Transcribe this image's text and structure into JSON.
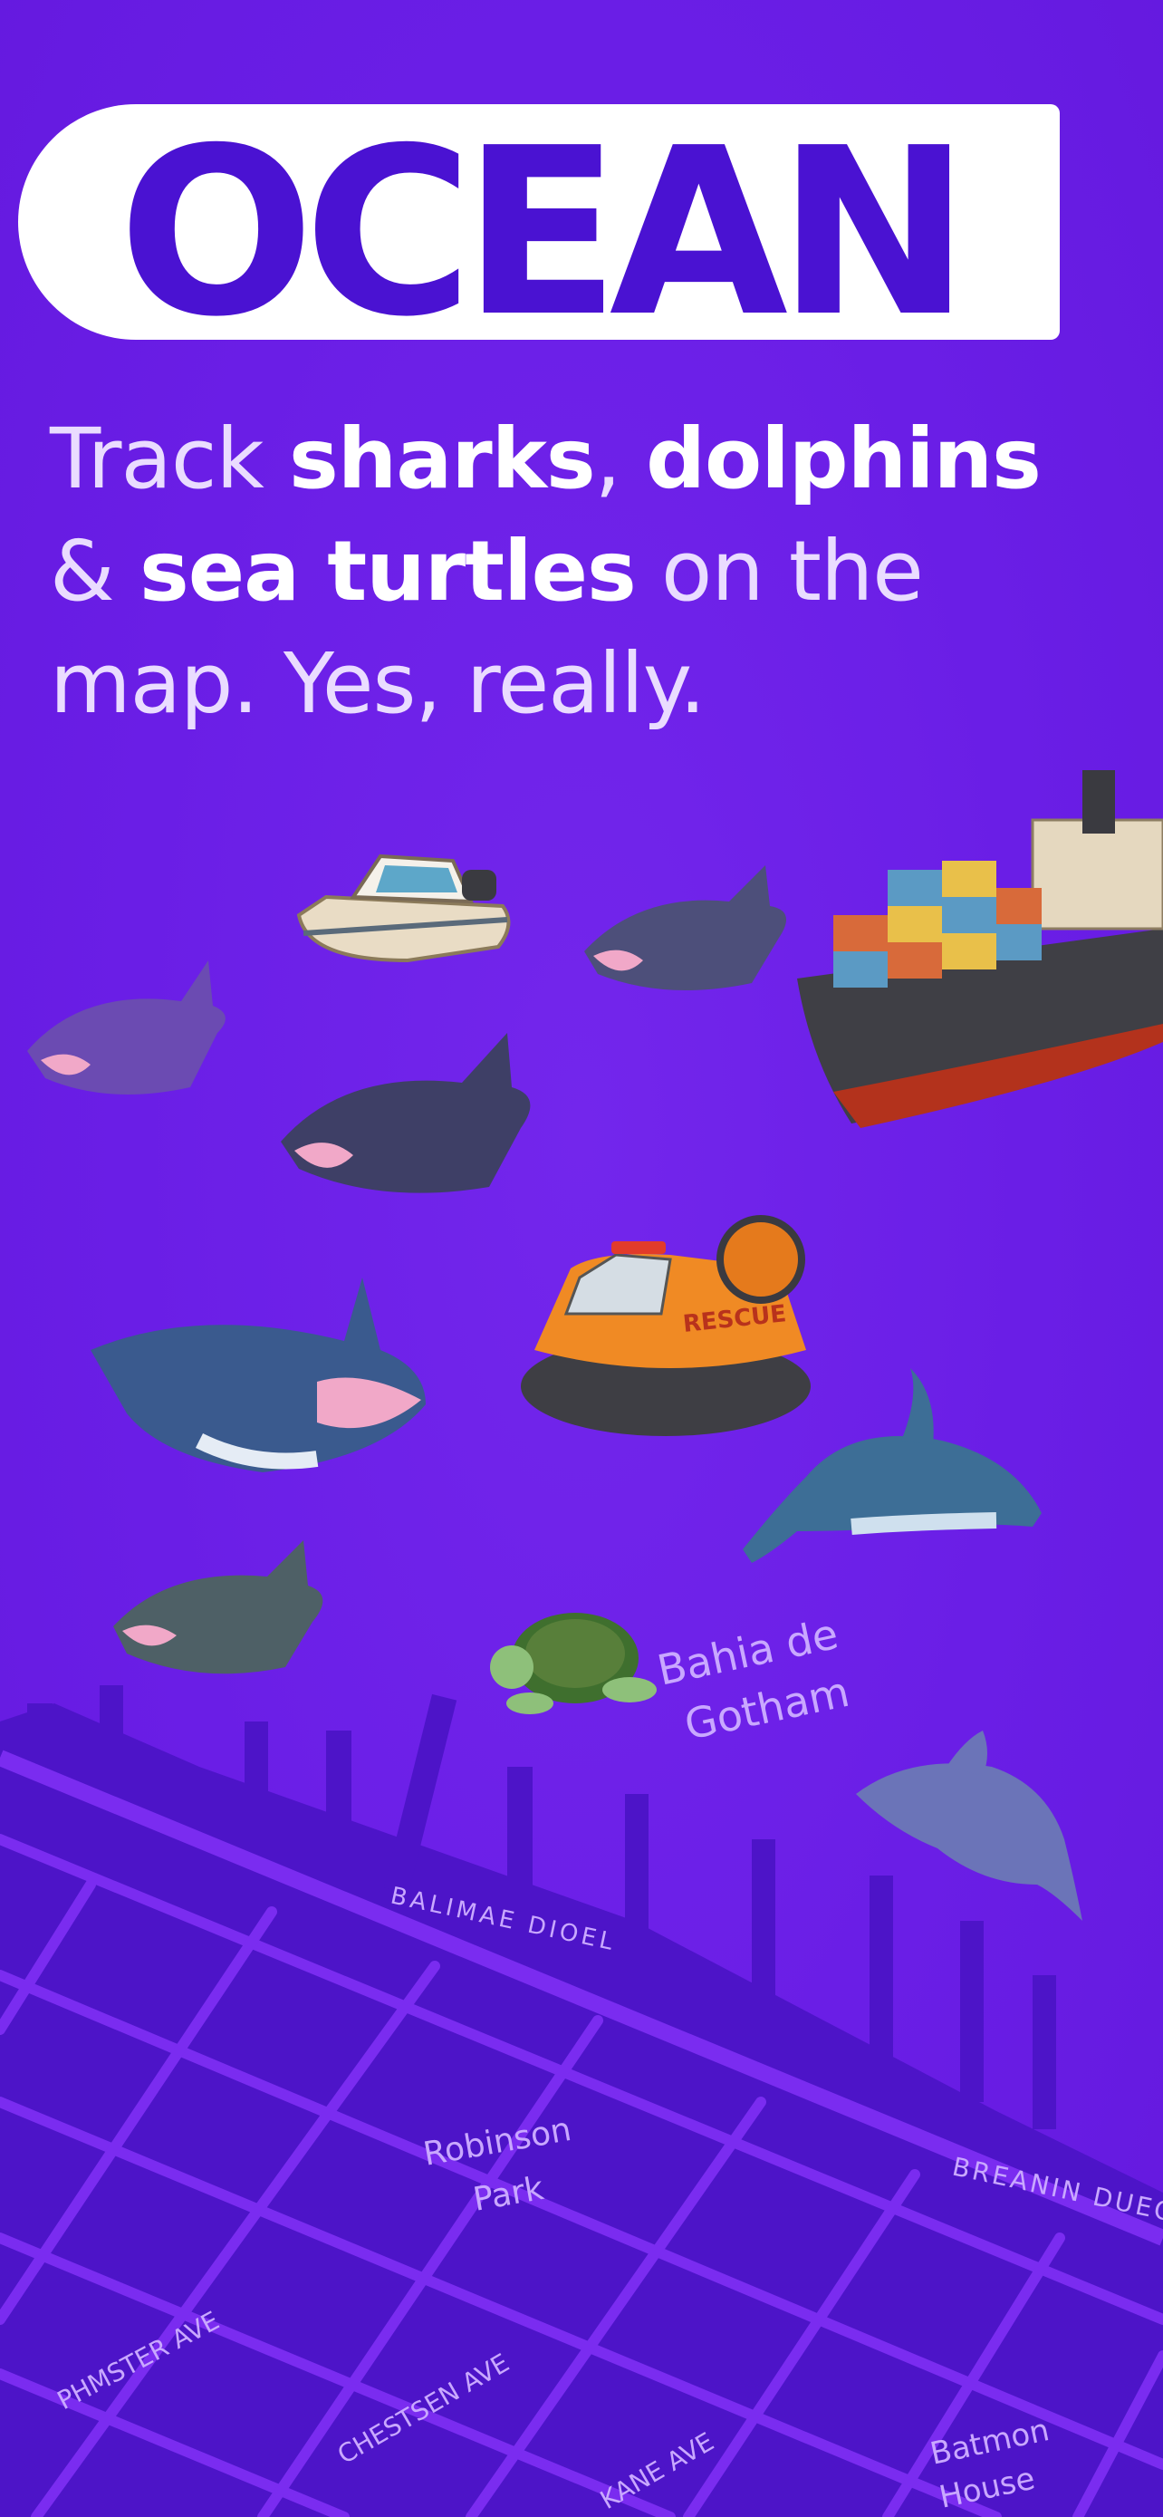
{
  "brand": {
    "title": "OCEAN"
  },
  "tagline": {
    "part1": "Track ",
    "sharks": "sharks",
    "comma": ", ",
    "dolphins": "dolphins",
    "line2_start": "& ",
    "turtles": "sea turtles",
    "line2_end": " on the",
    "line3": "map. Yes, really."
  },
  "map": {
    "bay_label_1": "Bahia de",
    "bay_label_2": "Gotham",
    "shore_street": "BALIMAE DIOEL",
    "shore_street_2": "BREANIN DUEO",
    "park_1": "Robinson",
    "park_2": "Park",
    "street_1": "PHMSTER AVE",
    "street_2": "CHESTSEN AVE",
    "street_3": "KANE AVE",
    "house_1": "Batmon",
    "house_2": "House"
  },
  "hovercraft_label": "RESCUE",
  "colors": {
    "background": "#6a1ee6",
    "title_fill": "#4a12d2",
    "title_outline": "#ffffff",
    "land": "#4d14c8",
    "streets": "#7a2cf0",
    "text_light": "#eadcff"
  }
}
